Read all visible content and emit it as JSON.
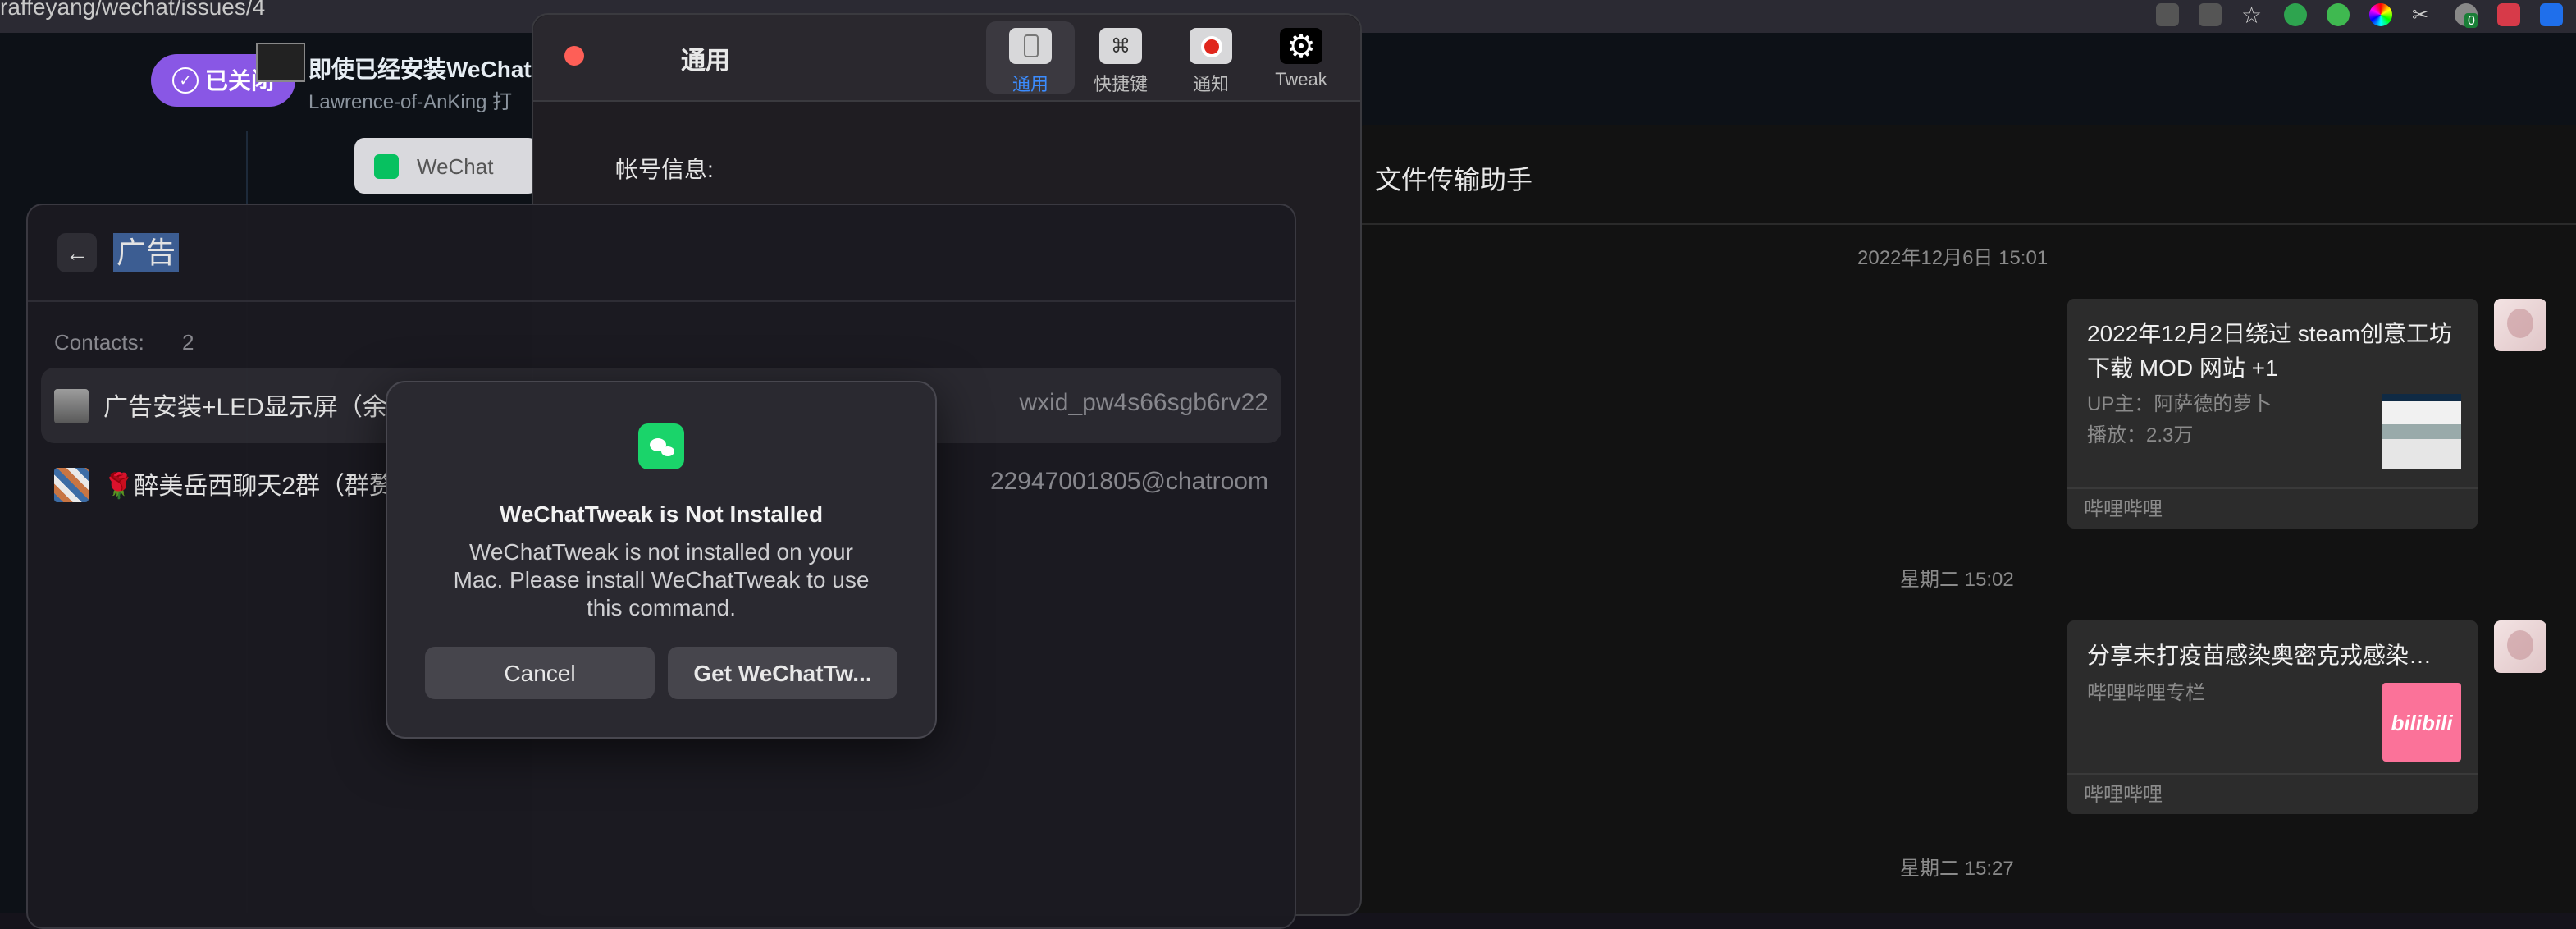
{
  "browser": {
    "url": "raffeyang/wechat/issues/4",
    "extension_badge": "0"
  },
  "issue": {
    "state_label": "已关闭",
    "title": "即使已经安装WeChat",
    "author_line": "Lawrence-of-AnKing 打"
  },
  "wechat_tab": {
    "label": "WeChat"
  },
  "settings": {
    "title": "通用",
    "toolbar": [
      {
        "label": "通用",
        "icon": "switch-icon",
        "active": true
      },
      {
        "label": "快捷键",
        "icon": "command-icon",
        "glyph": "⌘",
        "active": false
      },
      {
        "label": "通知",
        "icon": "record-icon",
        "active": false
      },
      {
        "label": "Tweak",
        "icon": "gear-icon",
        "glyph": "⚙",
        "active": false
      }
    ],
    "account_label": "帐号信息:"
  },
  "raycast": {
    "search_text": "广告",
    "section_label": "Contacts:",
    "section_count": "2",
    "rows": [
      {
        "name": "广告安装+LED显示屏（余",
        "account": "wxid_pw4s66sgb6rv22",
        "selected": true
      },
      {
        "name": "🌹醉美岳西聊天2群（群赘",
        "account": "22947001805@chatroom",
        "selected": false
      }
    ]
  },
  "alert": {
    "title": "WeChatTweak is Not Installed",
    "message": "WeChatTweak is not installed on your Mac. Please install WeChatTweak to use this command.",
    "cancel_label": "Cancel",
    "confirm_label": "Get WeChatTw..."
  },
  "chat": {
    "title": "文件传输助手",
    "messages": [
      {
        "timestamp": "2022年12月6日 15:01",
        "title": "2022年12月2日绕过 steam创意工坊下载 MOD 网站 +1",
        "meta": [
          "UP主：阿萨德的萝卜",
          "播放：2.3万"
        ],
        "source": "哔哩哔哩",
        "thumb": "video"
      },
      {
        "timestamp": "星期二 15:02",
        "title": "分享未打疫苗感染奥密克戎感染…",
        "meta": [
          "哔哩哔哩专栏"
        ],
        "source": "哔哩哔哩",
        "thumb": "bilibili",
        "thumb_text": "bilibili"
      }
    ],
    "last_timestamp": "星期二 15:27"
  },
  "colors": {
    "accent_purple": "#8957e5",
    "wechat_green": "#07c160",
    "bilibili_pink": "#fb7299",
    "selected_blue": "#3b8cff"
  }
}
